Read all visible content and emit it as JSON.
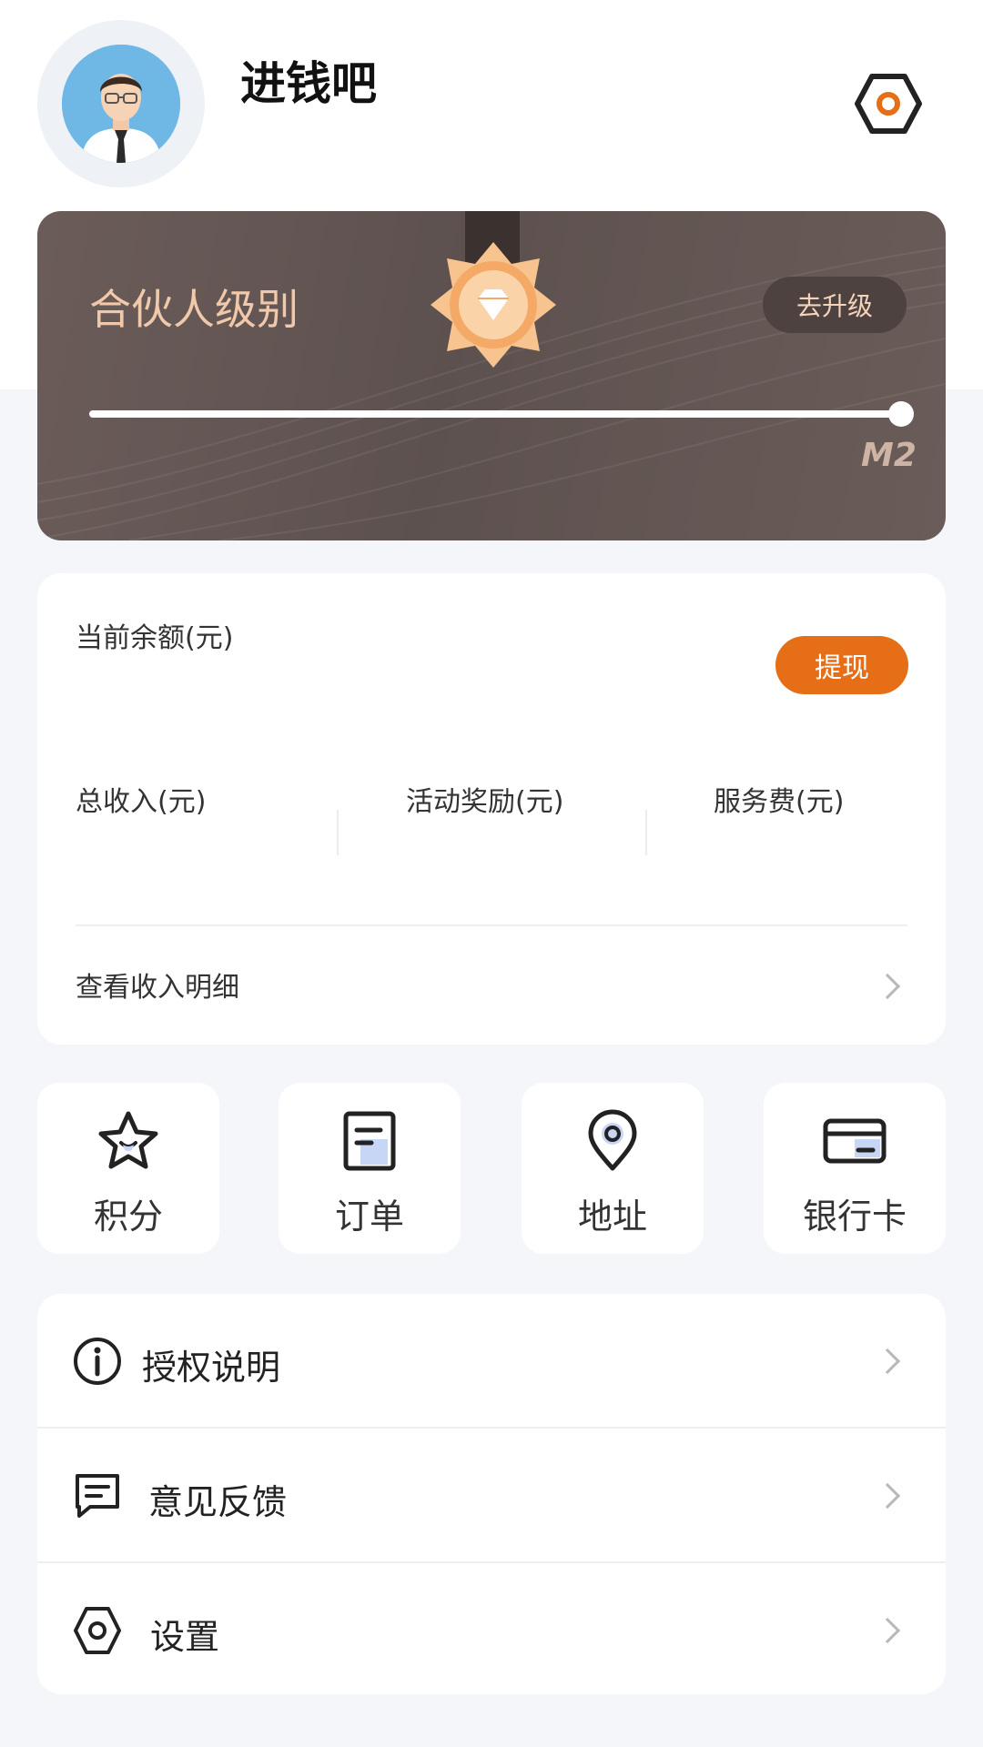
{
  "header": {
    "app_name": "进钱吧",
    "avatar": "businessman-avatar",
    "settings_icon": "hexagon-gear-icon",
    "accent": "#e56e16"
  },
  "level_card": {
    "title": "合伙人级别",
    "upgrade_label": "去升级",
    "progress": 1.0,
    "level_badge": "M2",
    "medal_icon": "diamond-medal-icon",
    "colors": {
      "card": "#5f5350",
      "title": "#f1c8a9",
      "medal": "#f5b77a"
    }
  },
  "balance": {
    "current_label": "当前余额(元)",
    "withdraw_label": "提现",
    "stats": [
      {
        "label": "总收入(元)"
      },
      {
        "label": "活动奖励(元)"
      },
      {
        "label": "服务费(元)"
      }
    ],
    "detail_label": "查看收入明细"
  },
  "tiles": [
    {
      "label": "积分",
      "icon": "star-icon"
    },
    {
      "label": "订单",
      "icon": "order-icon"
    },
    {
      "label": "地址",
      "icon": "location-pin-icon"
    },
    {
      "label": "银行卡",
      "icon": "bank-card-icon"
    }
  ],
  "menu": [
    {
      "label": "授权说明",
      "icon": "info-icon"
    },
    {
      "label": "意见反馈",
      "icon": "feedback-icon"
    },
    {
      "label": "设置",
      "icon": "settings-icon"
    }
  ]
}
